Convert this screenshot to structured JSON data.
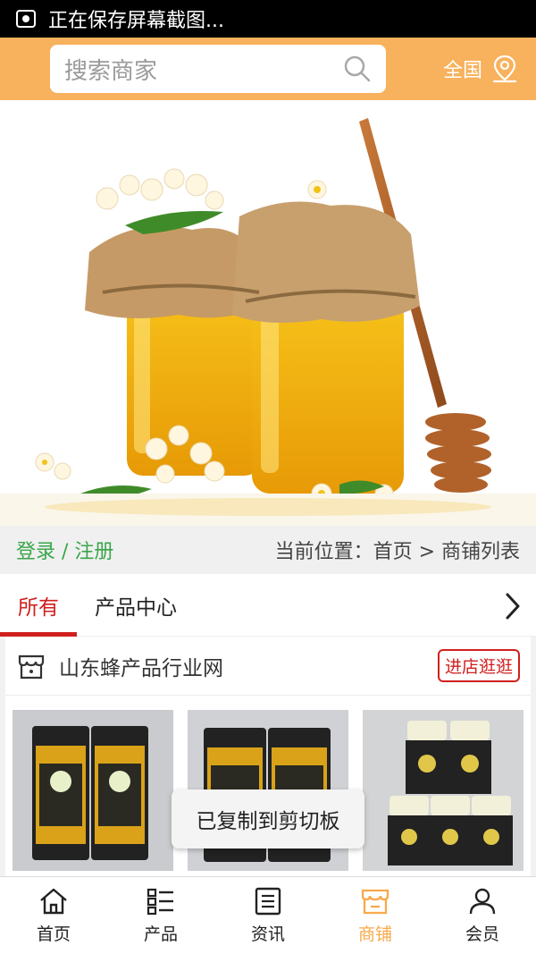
{
  "status_bar": {
    "text": "正在保存屏幕截图..."
  },
  "header": {
    "search_placeholder": "搜索商家",
    "region": "全国"
  },
  "crumb": {
    "login": "登录 / 注册",
    "location": "当前位置：首页 > 商铺列表"
  },
  "tabs": [
    {
      "label": "所有"
    },
    {
      "label": "产品中心"
    }
  ],
  "shop": {
    "name": "山东蜂产品行业网",
    "visit_label": "进店逛逛"
  },
  "toast": {
    "text": "已复制到剪切板"
  },
  "bottom_nav": [
    {
      "label": "首页",
      "icon": "home-icon"
    },
    {
      "label": "产品",
      "icon": "list-icon"
    },
    {
      "label": "资讯",
      "icon": "news-icon"
    },
    {
      "label": "商铺",
      "icon": "shop-icon"
    },
    {
      "label": "会员",
      "icon": "user-icon"
    }
  ],
  "colors": {
    "header": "#f8b15c",
    "accent_red": "#d0201e",
    "login_green": "#3aa64a",
    "nav_active": "#f8a94a"
  }
}
